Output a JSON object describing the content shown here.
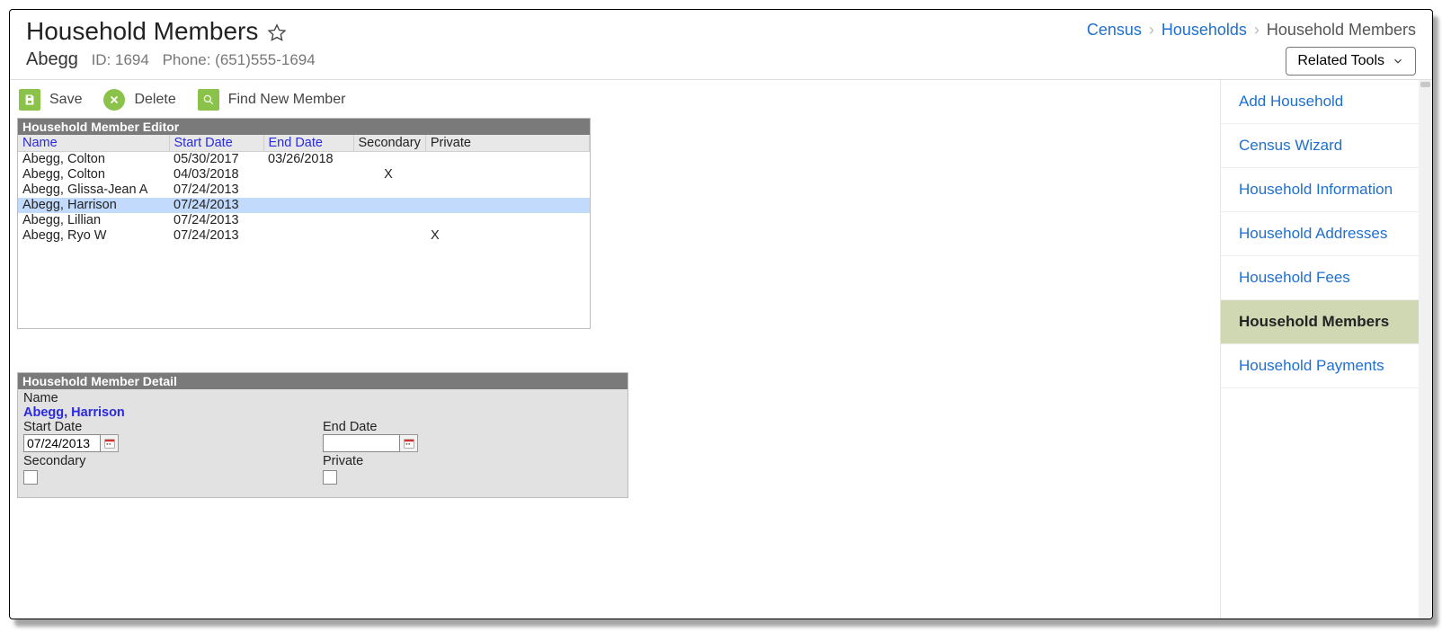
{
  "page_title": "Household Members",
  "household_name": "Abegg",
  "household_id_label": "ID: 1694",
  "household_phone_label": "Phone: (651)555-1694",
  "breadcrumbs": {
    "a": "Census",
    "b": "Households",
    "c": "Household Members"
  },
  "related_tools_label": "Related Tools",
  "toolbar": {
    "save": "Save",
    "delete": "Delete",
    "find": "Find New Member"
  },
  "editor_title": "Household Member Editor",
  "columns": {
    "name": "Name",
    "start_date": "Start Date",
    "end_date": "End Date",
    "secondary": "Secondary",
    "private": "Private"
  },
  "members": [
    {
      "name": "Abegg, Colton",
      "start": "05/30/2017",
      "end": "03/26/2018",
      "secondary": "",
      "private": ""
    },
    {
      "name": "Abegg, Colton",
      "start": "04/03/2018",
      "end": "",
      "secondary": "X",
      "private": ""
    },
    {
      "name": "Abegg, Glissa-Jean A",
      "start": "07/24/2013",
      "end": "",
      "secondary": "",
      "private": ""
    },
    {
      "name": "Abegg, Harrison",
      "start": "07/24/2013",
      "end": "",
      "secondary": "",
      "private": ""
    },
    {
      "name": "Abegg, Lillian",
      "start": "07/24/2013",
      "end": "",
      "secondary": "",
      "private": ""
    },
    {
      "name": "Abegg, Ryo W",
      "start": "07/24/2013",
      "end": "",
      "secondary": "",
      "private": "X"
    }
  ],
  "selected_index": 3,
  "detail_title": "Household Member Detail",
  "detail": {
    "name_label": "Name",
    "name_value": "Abegg, Harrison",
    "start_label": "Start Date",
    "start_value": "07/24/2013",
    "end_label": "End Date",
    "end_value": "",
    "secondary_label": "Secondary",
    "private_label": "Private",
    "secondary_checked": false,
    "private_checked": false
  },
  "side_nav": [
    {
      "label": "Add Household",
      "active": false
    },
    {
      "label": "Census Wizard",
      "active": false
    },
    {
      "label": "Household Information",
      "active": false
    },
    {
      "label": "Household Addresses",
      "active": false
    },
    {
      "label": "Household Fees",
      "active": false
    },
    {
      "label": "Household Members",
      "active": true
    },
    {
      "label": "Household Payments",
      "active": false
    }
  ]
}
